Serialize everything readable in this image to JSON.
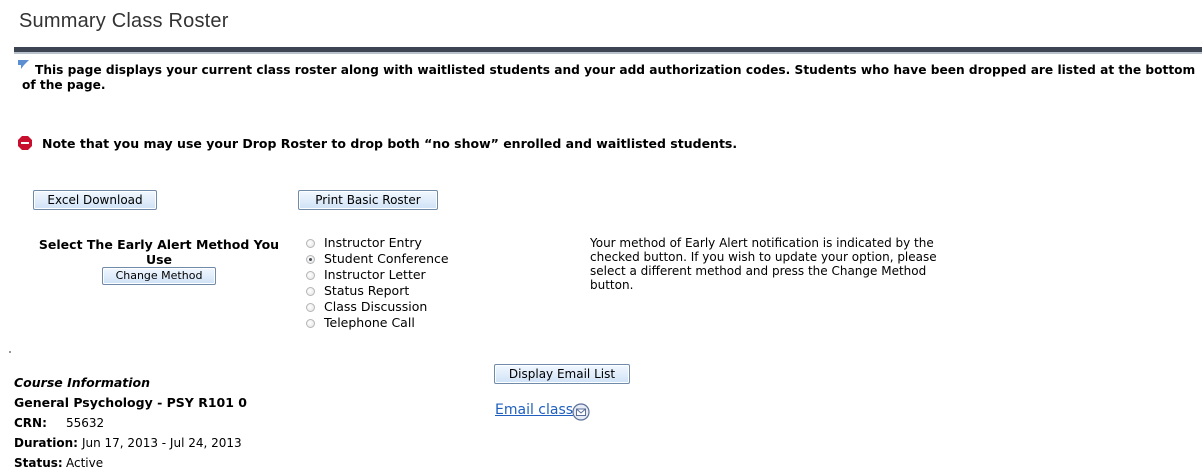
{
  "page": {
    "title": "Summary Class Roster"
  },
  "intro": {
    "text": "This page displays your current class roster along with waitlisted students and your add authorization codes. Students who have been dropped are listed at the bottom of the page."
  },
  "note": {
    "text": "Note that you may use your Drop Roster to drop both “no show” enrolled and waitlisted students."
  },
  "buttons": {
    "excel_download": "Excel Download",
    "print_basic_roster": "Print Basic Roster",
    "change_method": "Change Method",
    "display_email_list": "Display Email List"
  },
  "early_alert": {
    "label": "Select The Early Alert Method You Use",
    "options": [
      {
        "label": "Instructor Entry",
        "checked": false
      },
      {
        "label": "Student Conference",
        "checked": true
      },
      {
        "label": "Instructor Letter",
        "checked": false
      },
      {
        "label": "Status Report",
        "checked": false
      },
      {
        "label": "Class Discussion",
        "checked": false
      },
      {
        "label": "Telephone Call",
        "checked": false
      }
    ],
    "description": "Your method of Early Alert notification is indicated by the checked button. If you wish to update your option, please select a different method and press the Change Method button."
  },
  "course": {
    "heading": "Course Information",
    "name": "General Psychology - PSY R101 0",
    "crn_label": "CRN:",
    "crn_value": "55632",
    "duration_label": "Duration:",
    "duration_value": "Jun 17, 2013 - Jul 24, 2013",
    "status_label": "Status:",
    "status_value": "Active"
  },
  "email": {
    "link_text": "Email class"
  },
  "colors": {
    "rule": "#3c4551",
    "button_border": "#6f8ba9",
    "link": "#1f5fbf",
    "stop": "#c8102e"
  },
  "icons": {
    "intro": "info-pointer-icon",
    "note": "stop-sign-icon",
    "email": "envelope-icon"
  }
}
